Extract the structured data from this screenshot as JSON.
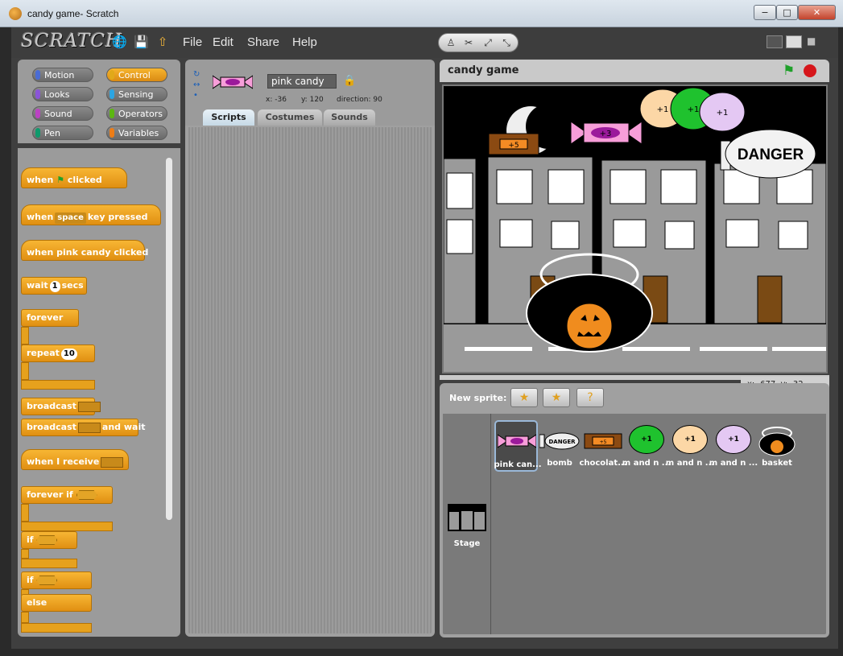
{
  "window": {
    "title": "candy game- Scratch",
    "min_label": "−",
    "max_label": "□",
    "close_label": "✕"
  },
  "app": {
    "logo": "SCRATCH",
    "menus": [
      "File",
      "Edit",
      "Share",
      "Help"
    ]
  },
  "categories": [
    {
      "label": "Motion",
      "color": "#4a6cd4"
    },
    {
      "label": "Control",
      "color": "#e1a91a",
      "active": true
    },
    {
      "label": "Looks",
      "color": "#8a55d7"
    },
    {
      "label": "Sensing",
      "color": "#2ca5e2"
    },
    {
      "label": "Sound",
      "color": "#bb42c3"
    },
    {
      "label": "Operators",
      "color": "#5cb712"
    },
    {
      "label": "Pen",
      "color": "#0e9a6c"
    },
    {
      "label": "Variables",
      "color": "#ee7d16"
    }
  ],
  "blocks": {
    "when_flag_a": "when",
    "when_flag_b": "clicked",
    "when_key_a": "when",
    "when_key_val": "space",
    "when_key_b": "key pressed",
    "when_sprite_clicked": "when pink candy clicked",
    "wait_a": "wait",
    "wait_val": "1",
    "wait_b": "secs",
    "forever": "forever",
    "repeat": "repeat",
    "repeat_val": "10",
    "broadcast": "broadcast",
    "broadcast_wait_a": "broadcast",
    "broadcast_wait_b": "and wait",
    "when_receive": "when I receive",
    "forever_if": "forever if",
    "if": "if",
    "if2": "if",
    "else": "else"
  },
  "sprite_info": {
    "name": "pink candy",
    "x_label": "x:",
    "x": "-36",
    "y_label": "y:",
    "y": "120",
    "dir_label": "direction:",
    "direction": "90"
  },
  "tabs": [
    "Scripts",
    "Costumes",
    "Sounds"
  ],
  "stage": {
    "title": "candy game",
    "danger_text": "DANGER",
    "candy_label": "+3",
    "chocolate_label": "+5",
    "mm_labels": [
      "+1",
      "+1",
      "+1"
    ],
    "mouse_x_label": "x:",
    "mouse_x": "-677",
    "mouse_y_label": "y:",
    "mouse_y": "-32"
  },
  "sprites_panel": {
    "new_sprite_label": "New sprite:",
    "stage_label": "Stage",
    "sprites": [
      {
        "label": "pink can...",
        "selected": true
      },
      {
        "label": "bomb"
      },
      {
        "label": "chocolat..."
      },
      {
        "label": "m and n ...",
        "color": "#1fc22e",
        "text": "+1"
      },
      {
        "label": "m and n ...",
        "color": "#fcd7a6",
        "text": "+1"
      },
      {
        "label": "m and n ...",
        "color": "#e4c8f3",
        "text": "+1"
      },
      {
        "label": "basket"
      }
    ],
    "bomb_text": "DANGER",
    "chocolate_text": "+5"
  }
}
